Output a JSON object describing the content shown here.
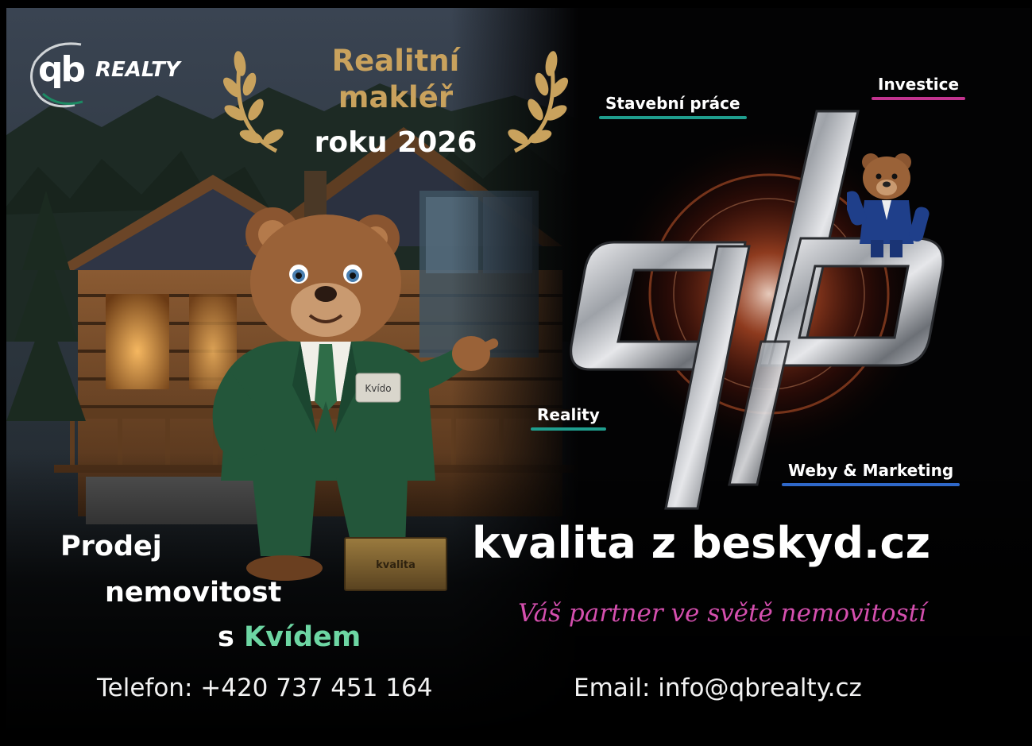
{
  "logo": {
    "glyphs": "qb",
    "text": "REALTY"
  },
  "award": {
    "line1": "Realitní",
    "line2": "makléř",
    "line3": "roku 2026"
  },
  "services": {
    "construction": "Stavební práce",
    "investment": "Investice",
    "reality": "Reality",
    "web_marketing": "Weby & Marketing"
  },
  "mascot": {
    "name_badge": "Kvído",
    "pedestal_label": "kvalita"
  },
  "emblem": {
    "glyphs": "qb"
  },
  "domain_heading": "kvalita z beskyd.cz",
  "slogan": "Váš partner ve světě nemovitostí",
  "promo": {
    "line1": "Prodej",
    "line2": "nemovitost",
    "line3_prefix": "s",
    "line3_highlight": "Kvídem"
  },
  "contact": {
    "phone": "Telefon: +420 737 451 164",
    "email": "Email: info@qbrealty.cz"
  },
  "colors": {
    "gold": "#c9a25d",
    "highlight_green": "#6dd6a3",
    "slogan_pink": "#d44fae",
    "underline_teal": "#1f9e8e",
    "underline_pink": "#c2338f",
    "underline_blue": "#2f68c9",
    "suit_green": "#23563a"
  }
}
